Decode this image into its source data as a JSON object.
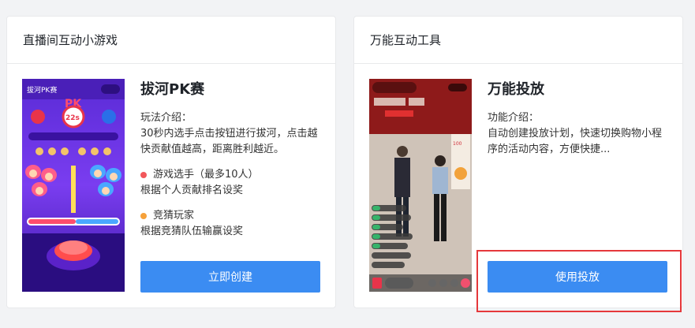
{
  "left_card": {
    "header": "直播间互动小游戏",
    "thumb_title": "拔河PK赛",
    "thumb_pk": "PK",
    "thumb_timer": "22s",
    "title": "拔河PK赛",
    "intro_label": "玩法介绍：",
    "intro_text": "30秒内选手点击按钮进行拔河，点击越快贡献值越高，距离胜利越近。",
    "bullet1_title": "游戏选手（最多10人）",
    "bullet1_desc": "根据个人贡献排名设奖",
    "bullet2_title": "竞猜玩家",
    "bullet2_desc": "根据竞猜队伍输赢设奖",
    "button_label": "立即创建",
    "colors": {
      "bullet1": "#f2575b",
      "bullet2": "#f6a13a"
    }
  },
  "right_card": {
    "header": "万能互动工具",
    "title": "万能投放",
    "intro_label": "功能介绍：",
    "intro_text": "自动创建投放计划，快速切换购物小程序的活动内容，方便快捷...",
    "button_label": "使用投放"
  },
  "colors": {
    "primary": "#3b8cf2",
    "highlight": "#e5383b"
  }
}
